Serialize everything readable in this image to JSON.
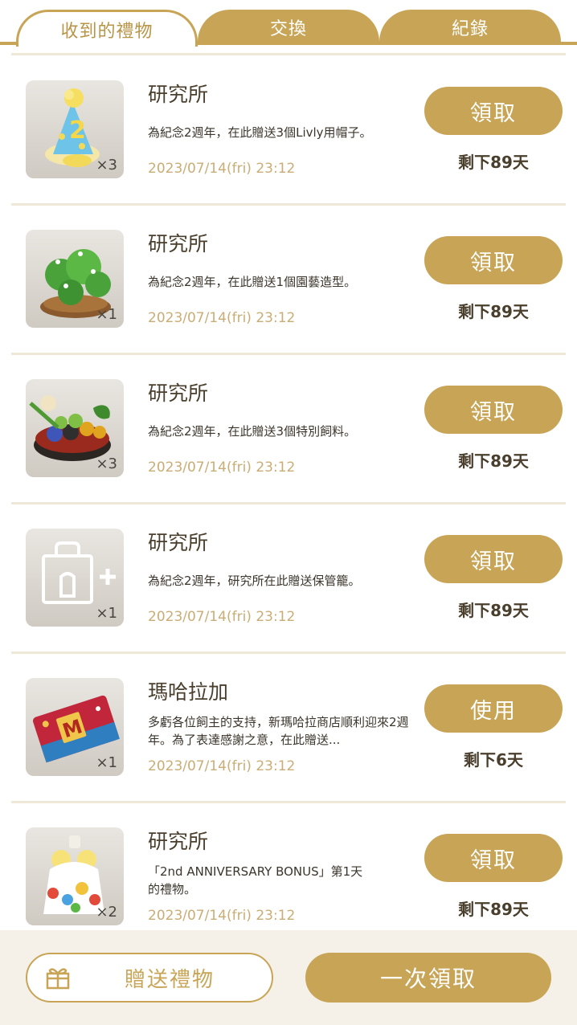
{
  "tabs": [
    {
      "label": "收到的禮物",
      "active": true
    },
    {
      "label": "交換",
      "active": false
    },
    {
      "label": "紀錄",
      "active": false
    }
  ],
  "gifts": [
    {
      "sender": "研究所",
      "description": "為紀念2週年，在此贈送3個Livly用帽子。",
      "date": "2023/07/14(fri) 23:12",
      "quantity": "×3",
      "action": "領取",
      "remaining": "剩下89天",
      "icon": "party-hat-icon"
    },
    {
      "sender": "研究所",
      "description": "為紀念2週年，在此贈送1個園藝造型。",
      "date": "2023/07/14(fri) 23:12",
      "quantity": "×1",
      "action": "領取",
      "remaining": "剩下89天",
      "icon": "topiary-icon"
    },
    {
      "sender": "研究所",
      "description": "為紀念2週年，在此贈送3個特別飼料。",
      "date": "2023/07/14(fri) 23:12",
      "quantity": "×3",
      "action": "領取",
      "remaining": "剩下89天",
      "icon": "food-plate-icon"
    },
    {
      "sender": "研究所",
      "description": "為紀念2週年，研究所在此贈送保管籠。",
      "date": "2023/07/14(fri) 23:12",
      "quantity": "×1",
      "action": "領取",
      "remaining": "剩下89天",
      "icon": "storage-cage-icon"
    },
    {
      "sender": "瑪哈拉加",
      "description": "多虧各位飼主的支持，新瑪哈拉商店順利迎來2週年。為了表達感謝之意，在此贈送...",
      "date": "2023/07/14(fri) 23:12",
      "quantity": "×1",
      "action": "使用",
      "remaining": "剩下6天",
      "icon": "ticket-icon"
    },
    {
      "sender": "研究所",
      "description": "「2nd ANNIVERSARY BONUS」第1天的禮物。",
      "date": "2023/07/14(fri) 23:12",
      "quantity": "×2",
      "action": "領取",
      "remaining": "剩下89天",
      "icon": "costume-icon"
    }
  ],
  "footer": {
    "send_gift_label": "贈送禮物",
    "claim_all_label": "一次領取"
  },
  "colors": {
    "accent": "#c8a456",
    "date_text": "#c9ad76",
    "footer_bg": "#f5f1e8",
    "separator": "#efe8d8"
  }
}
